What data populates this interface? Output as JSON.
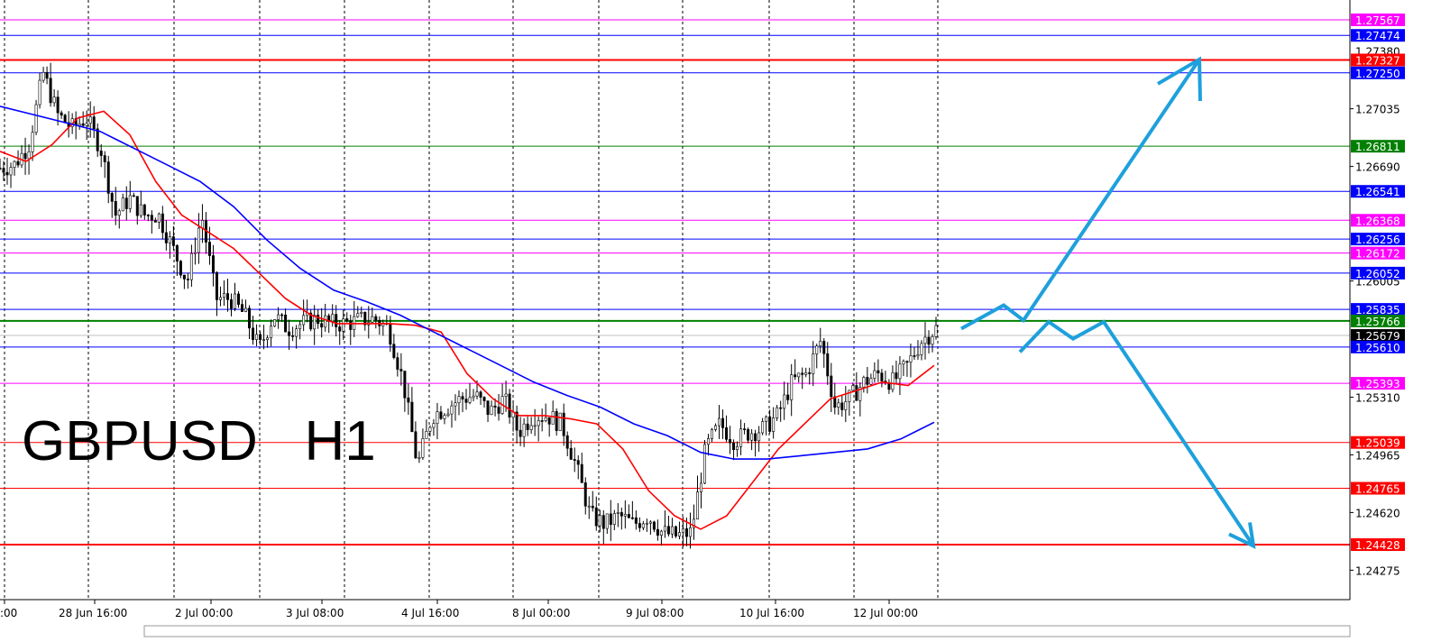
{
  "chart_data": {
    "type": "candlestick",
    "title": "GBPUSD   H1",
    "symbol": "GBPUSD",
    "timeframe": "H1",
    "ylim": [
      1.2415,
      1.2775
    ],
    "grid": true,
    "price_ticks": [
      "1.27035",
      "1.26690",
      "1.26005",
      "1.25310",
      "1.24965",
      "1.24620",
      "1.24275"
    ],
    "time_labels": [
      ":00",
      "28 Jun 16:00",
      "2 Jul 00:00",
      "3 Jul 08:00",
      "4 Jul 16:00",
      "8 Jul 00:00",
      "9 Jul 08:00",
      "10 Jul 16:00",
      "12 Jul 00:00"
    ],
    "levels": [
      {
        "label": "1.27567",
        "color": "#ff00ff"
      },
      {
        "label": "1.27474",
        "color": "#0000ff"
      },
      {
        "label": "1.27380",
        "color": "#000000"
      },
      {
        "label": "1.27327",
        "color": "#ff0000"
      },
      {
        "label": "1.27250",
        "color": "#0000ff"
      },
      {
        "label": "1.26811",
        "color": "#008000"
      },
      {
        "label": "1.26541",
        "color": "#0000ff"
      },
      {
        "label": "1.26368",
        "color": "#ff00ff"
      },
      {
        "label": "1.26256",
        "color": "#0000ff"
      },
      {
        "label": "1.26172",
        "color": "#ff00ff"
      },
      {
        "label": "1.26052",
        "color": "#0000ff"
      },
      {
        "label": "1.25835",
        "color": "#0000ff"
      },
      {
        "label": "1.25766",
        "color": "#008000"
      },
      {
        "label": "1.25679",
        "color": "#000000"
      },
      {
        "label": "1.25610",
        "color": "#0000ff"
      },
      {
        "label": "1.25393",
        "color": "#ff00ff"
      },
      {
        "label": "1.25039",
        "color": "#ff0000"
      },
      {
        "label": "1.24765",
        "color": "#ff0000"
      },
      {
        "label": "1.24428",
        "color": "#ff0000"
      }
    ],
    "close_path": [
      1.2668,
      1.267,
      1.2682,
      1.2725,
      1.27,
      1.2692,
      1.2698,
      1.268,
      1.264,
      1.265,
      1.264,
      1.264,
      1.262,
      1.26,
      1.264,
      1.259,
      1.259,
      1.258,
      1.256,
      1.258,
      1.2572,
      1.2575,
      1.2578,
      1.2575,
      1.2575,
      1.2577,
      1.2578,
      1.2572,
      1.254,
      1.249,
      1.252,
      1.2525,
      1.253,
      1.2532,
      1.2522,
      1.253,
      1.251,
      1.252,
      1.252,
      1.2515,
      1.249,
      1.246,
      1.2455,
      1.246,
      1.2455,
      1.246,
      1.245,
      1.2448,
      1.245,
      1.25,
      1.2515,
      1.2505,
      1.251,
      1.2512,
      1.252,
      1.254,
      1.2545,
      1.2565,
      1.2525,
      1.253,
      1.254,
      1.2545,
      1.254,
      1.255,
      1.2565,
      1.2572
    ],
    "moving_averages": [
      {
        "color": "#ff0000",
        "values": [
          1.2678,
          1.2672,
          1.2682,
          1.2698,
          1.2702,
          1.2688,
          1.266,
          1.264,
          1.263,
          1.262,
          1.2605,
          1.259,
          1.258,
          1.2575,
          1.2575,
          1.2575,
          1.2574,
          1.257,
          1.2545,
          1.253,
          1.252,
          1.252,
          1.2518,
          1.2515,
          1.25,
          1.2475,
          1.246,
          1.2452,
          1.246,
          1.248,
          1.25,
          1.2515,
          1.253,
          1.2535,
          1.254,
          1.2538,
          1.255
        ]
      },
      {
        "color": "#0000ff",
        "values": [
          1.2705,
          1.27,
          1.2695,
          1.269,
          1.268,
          1.267,
          1.266,
          1.2645,
          1.2625,
          1.2608,
          1.2595,
          1.2588,
          1.258,
          1.257,
          1.256,
          1.255,
          1.254,
          1.2532,
          1.2525,
          1.2515,
          1.2508,
          1.2498,
          1.2494,
          1.2494,
          1.2496,
          1.2498,
          1.25,
          1.2506,
          1.2516
        ]
      }
    ],
    "forecast": {
      "color": "#1ea0dc",
      "bullish_path": [
        1.2572,
        1.2586,
        1.2577,
        1.2733
      ],
      "bearish_path": [
        1.2558,
        1.2576,
        1.2566,
        1.2576,
        1.2442
      ]
    }
  }
}
